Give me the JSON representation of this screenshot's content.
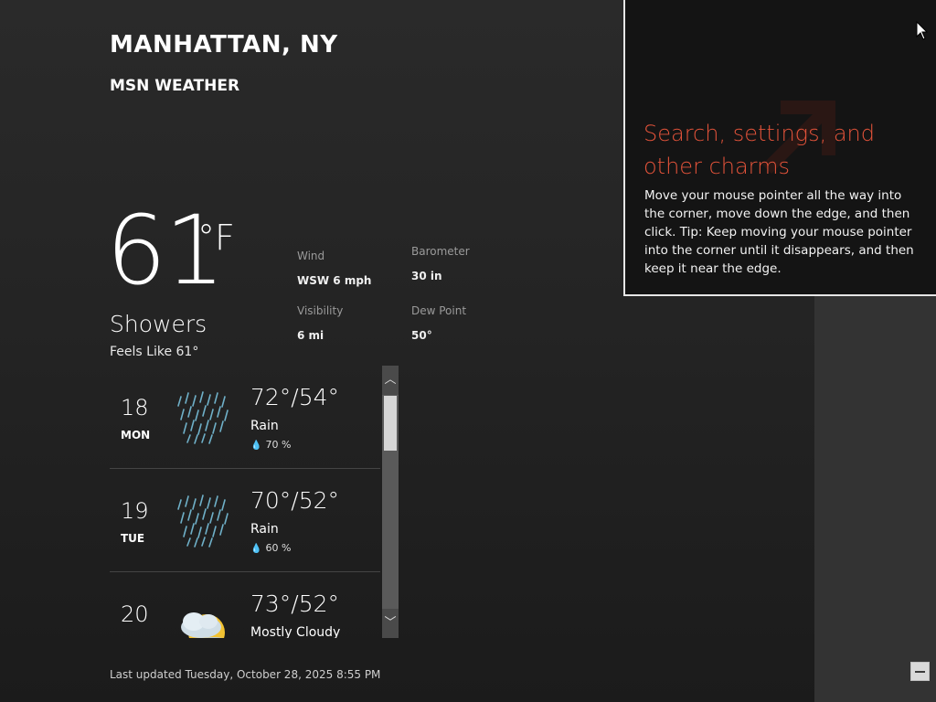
{
  "location": {
    "title": "MANHATTAN, NY",
    "app_name": "MSN WEATHER"
  },
  "current": {
    "temperature": "61",
    "unit": "°F",
    "condition": "Showers",
    "feels_like": "Feels Like 61°"
  },
  "details": {
    "wind_label": "Wind",
    "wind_value": "WSW 6 mph",
    "barometer_label": "Barometer",
    "barometer_value": "30 in",
    "visibility_label": "Visibility",
    "visibility_value": "6 mi",
    "dewpoint_label": "Dew Point",
    "dewpoint_value": "50°"
  },
  "forecast": [
    {
      "day_num": "18",
      "day_name": "MON",
      "temps": "72°/54°",
      "condition": "Rain",
      "precip": "70 %",
      "icon": "rain-icon"
    },
    {
      "day_num": "19",
      "day_name": "TUE",
      "temps": "70°/52°",
      "condition": "Rain",
      "precip": "60 %",
      "icon": "rain-icon"
    },
    {
      "day_num": "20",
      "day_name": "",
      "temps": "73°/52°",
      "condition": "Mostly Cloudy",
      "precip": "",
      "icon": "partly-cloudy-icon"
    }
  ],
  "scrollbar": {
    "up_glyph": "︿",
    "down_glyph": "﹀"
  },
  "last_updated": "Last updated Tuesday, October 28, 2025 8:55 PM",
  "charms_tip": {
    "title": "Search, settings, and other charms",
    "body": "Move your mouse pointer all the way into the corner, move down the edge, and then click. Tip: Keep moving your mouse pointer into the corner until it disappears, and then keep it near the edge."
  },
  "colors": {
    "accent": "#e3533a",
    "background": "#242424",
    "rain": "#6fb0c8"
  },
  "icons": {
    "precip_drop": "💧",
    "cursor": "mouse-pointer-icon",
    "minimize": "minimize-icon"
  }
}
